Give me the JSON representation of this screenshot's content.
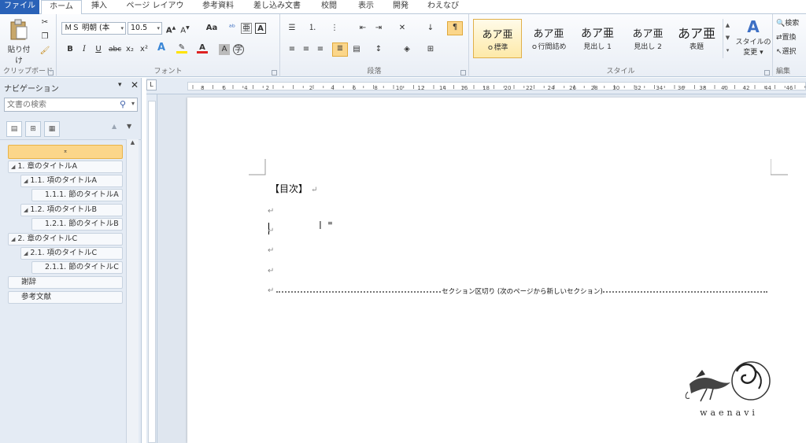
{
  "tabs": [
    "ファイル",
    "ホーム",
    "挿入",
    "ページ レイアウト",
    "参考資料",
    "差し込み文書",
    "校閲",
    "表示",
    "開発",
    "わえなび"
  ],
  "ribbon": {
    "clipboard": {
      "paste": "貼り付け",
      "label": "クリップボード"
    },
    "font": {
      "name": "ＭＳ 明朝 (本",
      "size": "10.5",
      "aa": "Aa",
      "label": "フォント"
    },
    "paragraph": {
      "label": "段落"
    },
    "styles": {
      "items": [
        {
          "sample": "あア亜",
          "name": "ｏ標準"
        },
        {
          "sample": "あア亜",
          "name": "ｏ行間詰め"
        },
        {
          "sample": "あア亜",
          "name": "見出し 1"
        },
        {
          "sample": "あア亜",
          "name": "見出し 2"
        },
        {
          "sample": "あア亜",
          "name": "表題"
        }
      ],
      "change_line1": "スタイルの",
      "change_line2": "変更",
      "label": "スタイル"
    },
    "editing": {
      "search": "検索",
      "replace": "置換",
      "select": "選択",
      "label": "編集"
    }
  },
  "nav": {
    "title": "ナビゲーション",
    "search_placeholder": "文書の検索",
    "items": [
      {
        "text": ""
      },
      {
        "text": "1.  章のタイトルA"
      },
      {
        "text": "1.1.  項のタイトルA"
      },
      {
        "text": "1.1.1.  節のタイトルA"
      },
      {
        "text": "1.2.  項のタイトルB"
      },
      {
        "text": "1.2.1.  節のタイトルB"
      },
      {
        "text": "2.  章のタイトルC"
      },
      {
        "text": "2.1.  項のタイトルC"
      },
      {
        "text": "2.1.1.  節のタイトルC"
      },
      {
        "text": "謝辞"
      },
      {
        "text": "参考文献"
      }
    ]
  },
  "ruler": {
    "corner": "L",
    "numbers": [
      "8",
      "6",
      "4",
      "2",
      "",
      "2",
      "4",
      "6",
      "8",
      "10",
      "12",
      "14",
      "16",
      "18",
      "20",
      "22",
      "24",
      "26",
      "28",
      "30",
      "32",
      "34",
      "36",
      "38",
      "40",
      "42",
      "44",
      "46"
    ]
  },
  "document": {
    "toc_heading": "【目次】",
    "section_break": "セクション区切り (次のページから新しいセクション)"
  },
  "logo_text": "waenavi"
}
